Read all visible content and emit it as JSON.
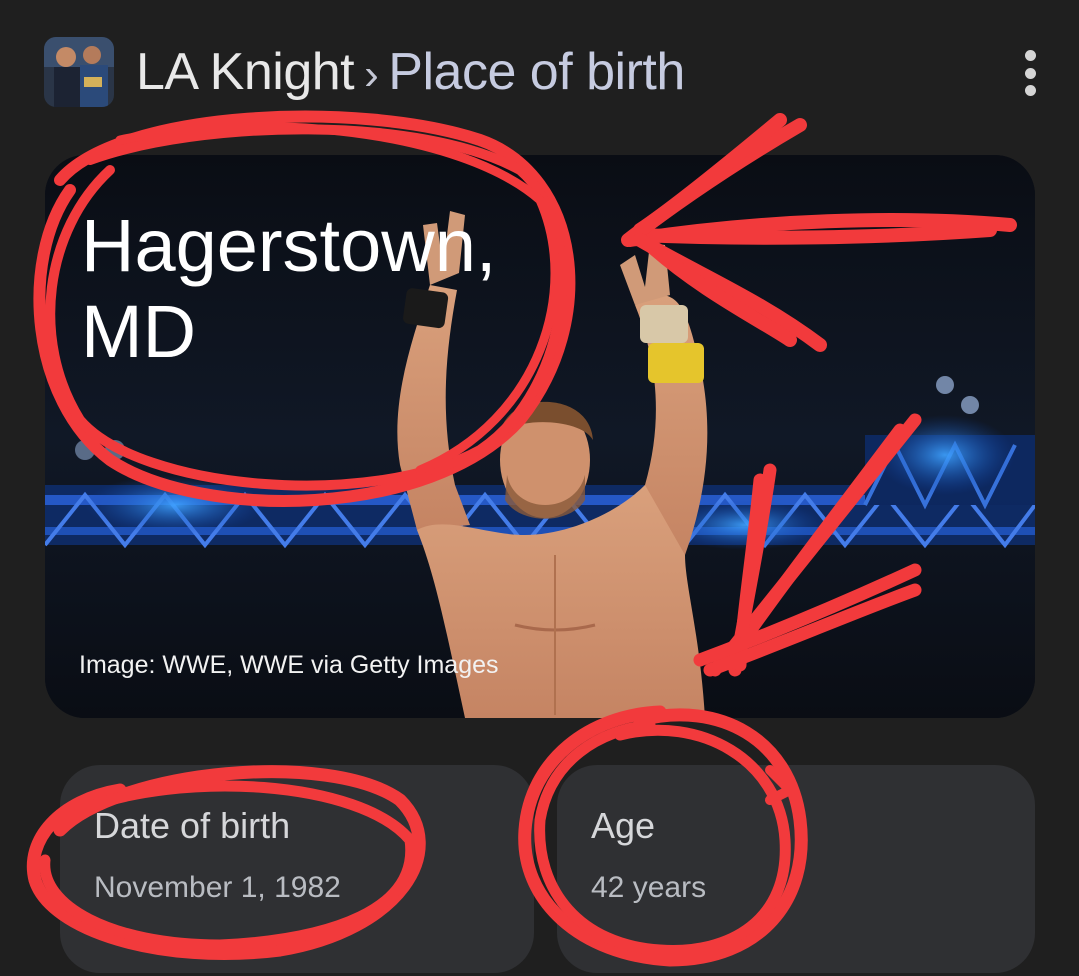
{
  "header": {
    "entity": "LA Knight",
    "separator": "›",
    "attribute": "Place of birth"
  },
  "hero": {
    "answer": "Hagerstown,\nMD",
    "credit": "Image: WWE, WWE via Getty Images"
  },
  "cards": [
    {
      "label": "Date of birth",
      "value": "November 1, 1982"
    },
    {
      "label": "Age",
      "value": "42 years"
    }
  ],
  "icons": {
    "menu": "more-vert-icon",
    "thumbnail": "entity-thumbnail-image"
  },
  "colors": {
    "background": "#1f1f1f",
    "card": "#2f3033",
    "annotation": "#f23a3c"
  }
}
